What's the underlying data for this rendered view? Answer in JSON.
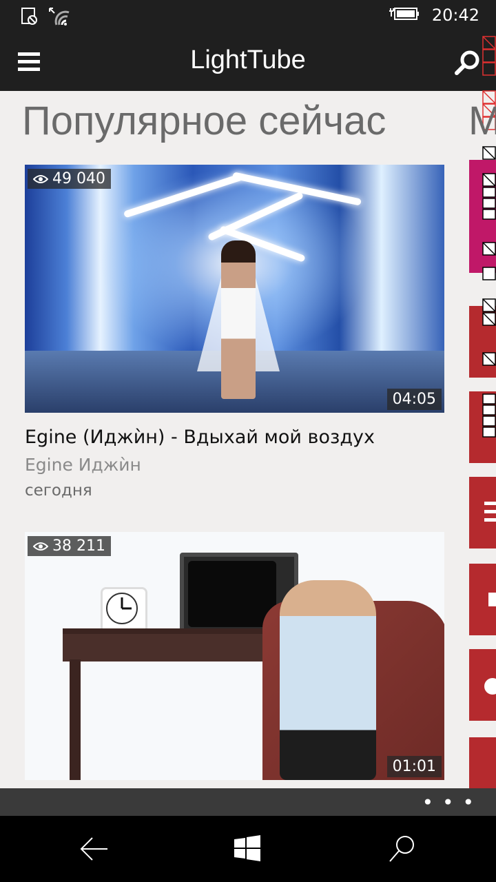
{
  "status_bar": {
    "time": "20:42",
    "icons": [
      "battery-saver-icon",
      "wifi-icon",
      "charging-battery-icon"
    ]
  },
  "app_bar": {
    "title": "LightTube",
    "menu_icon": "hamburger-icon",
    "search_icon": "search-icon"
  },
  "section": {
    "title": "Популярное сейчас",
    "next_title_partial": "М"
  },
  "videos": [
    {
      "views": "49 040",
      "duration": "04:05",
      "title": "Egine (Иджѝн) - Вдыхай мой воздух",
      "channel": "Egine Иджѝн",
      "date": "сегодня"
    },
    {
      "views": "38 211",
      "duration": "01:01",
      "title": "",
      "channel": "",
      "date": ""
    }
  ],
  "bottom_app_bar": {
    "more": "• • •"
  },
  "nav_bar": {
    "back_icon": "back-arrow-icon",
    "home_icon": "windows-logo-icon",
    "search_icon": "search-icon"
  },
  "colors": {
    "background": "#f1efee",
    "header": "#1f1f1f",
    "accent_red": "#b52a2e",
    "accent_magenta": "#c01868"
  }
}
